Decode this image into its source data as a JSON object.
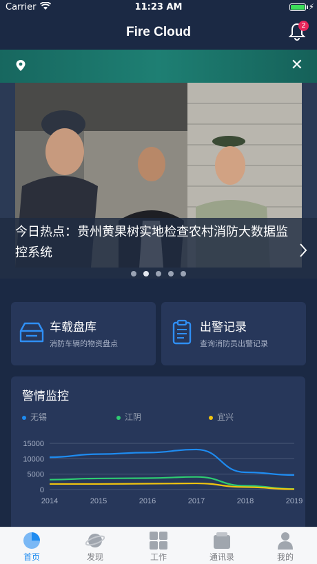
{
  "status_bar": {
    "carrier": "Carrier",
    "time": "11:23 AM"
  },
  "nav": {
    "title": "Fire Cloud",
    "badge_count": "2"
  },
  "banner": {
    "caption": "今日热点：贵州黄果树实地检查农村消防大数据监控系统",
    "slide_count": 5,
    "active_slide": 2
  },
  "cards": [
    {
      "title": "车载盘库",
      "subtitle": "消防车辆的物资盘点",
      "icon": "inbox-tray-icon"
    },
    {
      "title": "出警记录",
      "subtitle": "查询消防员出警记录",
      "icon": "clipboard-icon"
    }
  ],
  "panel": {
    "title": "警情监控"
  },
  "chart_data": {
    "type": "line",
    "x": [
      "2014",
      "2015",
      "2016",
      "2017",
      "2018",
      "2019"
    ],
    "y_ticks": [
      "15000",
      "10000",
      "5000",
      "0"
    ],
    "ylim": [
      0,
      15000
    ],
    "grid": true,
    "legend_position": "top",
    "series": [
      {
        "name": "无锡",
        "color": "#1e8bf0",
        "values": [
          10500,
          11500,
          12000,
          13000,
          5600,
          4700
        ]
      },
      {
        "name": "江阴",
        "color": "#2ecc71",
        "values": [
          3200,
          3600,
          3700,
          4100,
          1200,
          200
        ]
      },
      {
        "name": "宜兴",
        "color": "#f1c40f",
        "values": [
          1800,
          1800,
          1900,
          2000,
          800,
          100
        ]
      }
    ]
  },
  "tabs": [
    {
      "label": "首页",
      "icon": "home-pie-icon",
      "active": true
    },
    {
      "label": "发现",
      "icon": "planet-icon",
      "active": false
    },
    {
      "label": "工作",
      "icon": "grid-icon",
      "active": false
    },
    {
      "label": "通讯录",
      "icon": "contacts-icon",
      "active": false
    },
    {
      "label": "我的",
      "icon": "user-icon",
      "active": false
    }
  ],
  "colors": {
    "background": "#1b2944",
    "card": "#27375a",
    "accent": "#1e8bf0",
    "badge": "#e8265a"
  }
}
